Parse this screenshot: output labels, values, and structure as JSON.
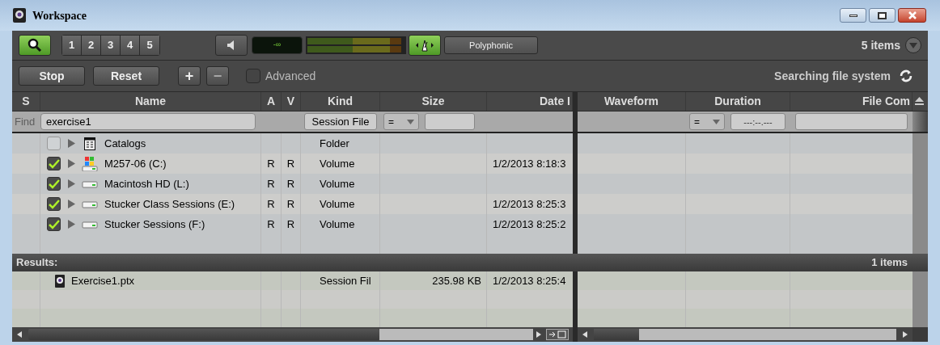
{
  "window": {
    "title": "Workspace"
  },
  "toolbar": {
    "search_button": {
      "selected": true
    },
    "number_buttons": [
      {
        "label": "1",
        "selected": false
      },
      {
        "label": "2",
        "selected": false
      },
      {
        "label": "3",
        "selected": false
      },
      {
        "label": "4",
        "selected": false
      },
      {
        "label": "5",
        "selected": false
      }
    ],
    "counter": "-∞",
    "metronome_button": {
      "selected": true
    },
    "mode_button": "Polyphonic",
    "item_count": "5 items"
  },
  "search_bar": {
    "buttons": [
      {
        "label": "Stop",
        "kind": "text",
        "disabled": false
      },
      {
        "label": "Reset",
        "kind": "text",
        "disabled": false
      },
      {
        "label": "+",
        "kind": "square",
        "disabled": false
      },
      {
        "label": "−",
        "kind": "square",
        "disabled": true
      }
    ],
    "advanced": {
      "label": "Advanced",
      "checked": false
    },
    "status": "Searching file system"
  },
  "table": {
    "columns": [
      "S",
      "Name",
      "A",
      "V",
      "Kind",
      "Size",
      "Date I",
      "Waveform",
      "Duration",
      "File Com"
    ],
    "find_row": {
      "label": "Find",
      "name": "exercise1",
      "kind": "Session File",
      "size_operator": "=",
      "duration_operator": "=",
      "duration_placeholder": "---:--.---"
    },
    "rows": [
      {
        "checked": false,
        "expanded": false,
        "kind": "catalog",
        "name": "Catalogs",
        "a": "",
        "v": "",
        "file_kind": "Folder",
        "date": ""
      },
      {
        "checked": true,
        "expanded": false,
        "kind": "system_drive",
        "name": "M257-06 (C:)",
        "a": "R",
        "v": "R",
        "file_kind": "Volume",
        "date": "1/2/2013 8:18:3"
      },
      {
        "checked": true,
        "expanded": false,
        "kind": "drive",
        "name": "Macintosh HD (L:)",
        "a": "R",
        "v": "R",
        "file_kind": "Volume",
        "date": ""
      },
      {
        "checked": true,
        "expanded": false,
        "kind": "drive",
        "name": "Stucker Class Sessions (E:)",
        "a": "R",
        "v": "R",
        "file_kind": "Volume",
        "date": "1/2/2013 8:25:3"
      },
      {
        "checked": true,
        "expanded": false,
        "kind": "drive",
        "name": "Stucker Sessions (F:)",
        "a": "R",
        "v": "R",
        "file_kind": "Volume",
        "date": "1/2/2013 8:25:2"
      }
    ]
  },
  "results": {
    "label": "Results:",
    "count": "1 items",
    "rows": [
      {
        "kind": "session",
        "name": "Exercise1.ptx",
        "file_kind": "Session Fil",
        "size": "235.98 KB",
        "date": "1/2/2013 8:25:4"
      }
    ]
  }
}
